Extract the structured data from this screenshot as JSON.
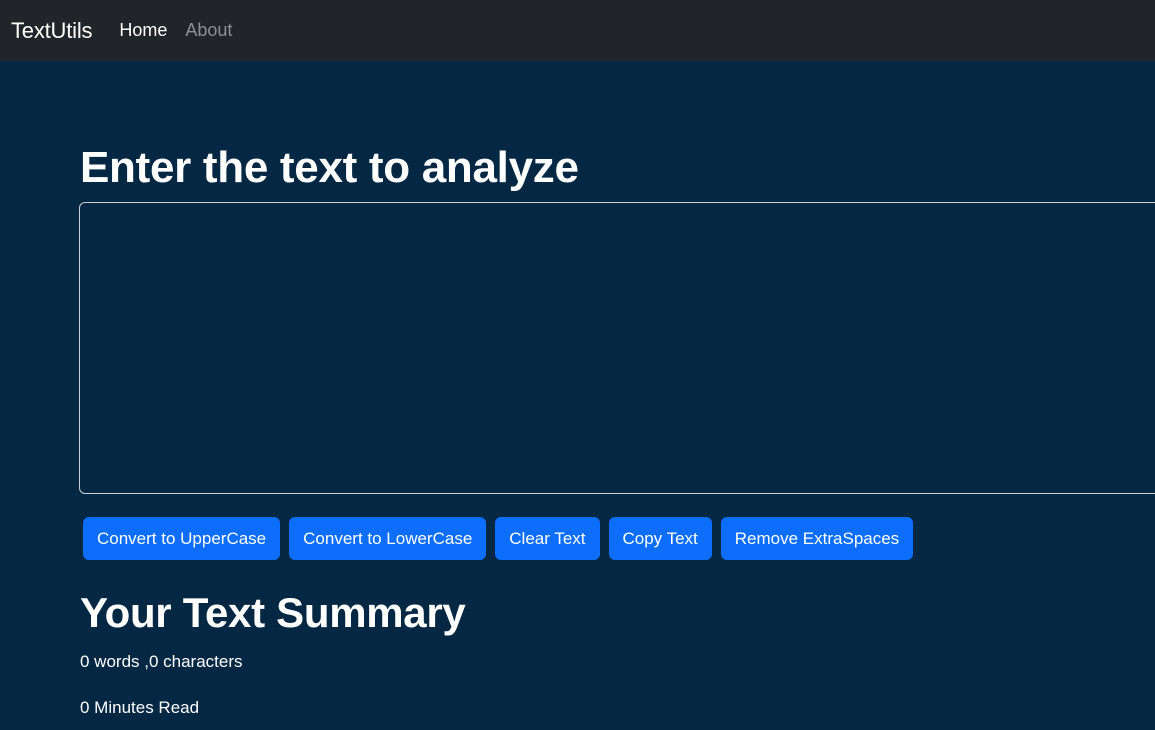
{
  "navbar": {
    "brand": "TextUtils",
    "links": [
      {
        "label": "Home",
        "active": true
      },
      {
        "label": "About",
        "active": false
      }
    ]
  },
  "form": {
    "heading": "Enter the text to analyze",
    "textarea_value": "",
    "buttons": [
      "Convert to UpperCase",
      "Convert to LowerCase",
      "Clear Text",
      "Copy Text",
      "Remove ExtraSpaces"
    ]
  },
  "summary": {
    "heading": "Your Text Summary",
    "counts": "0 words ,0 characters",
    "read_time": "0 Minutes Read"
  },
  "colors": {
    "page_background": "#042743",
    "navbar_background": "#212529",
    "button_primary": "#0d6efd"
  }
}
